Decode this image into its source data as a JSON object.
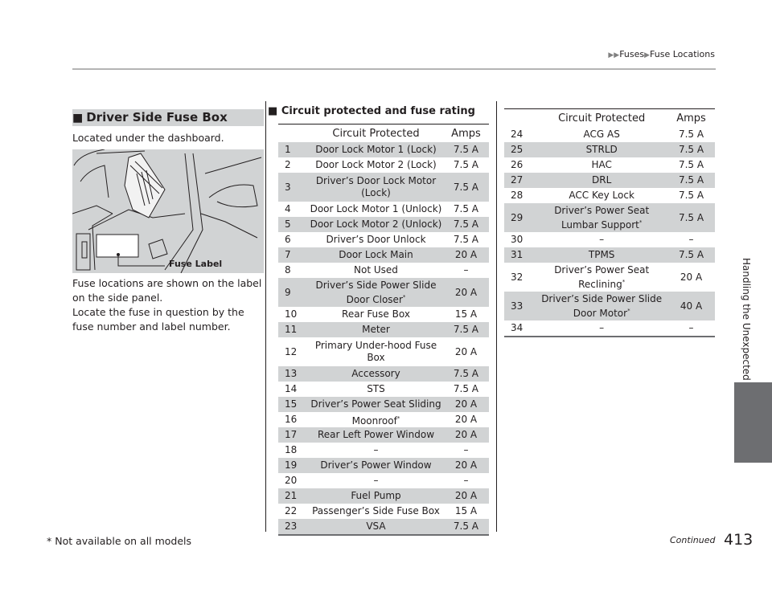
{
  "breadcrumb": {
    "items": [
      "Fuses",
      "Fuse Locations"
    ]
  },
  "side_tab": {
    "label": "Handling the Unexpected"
  },
  "left": {
    "section_title": "Driver Side Fuse Box",
    "intro": "Located under the dashboard.",
    "figure_callout": "Fuse Label",
    "body_lines": [
      "Fuse locations are shown on the label on the side panel.",
      "Locate the fuse in question by the fuse number and label number."
    ]
  },
  "table_section_title": "Circuit protected and fuse rating",
  "table_headers": {
    "num": "",
    "circuit": "Circuit Protected",
    "amps": "Amps"
  },
  "table1_rows": [
    {
      "num": "1",
      "circuit": "Door Lock Motor 1 (Lock)",
      "amps": "7.5 A"
    },
    {
      "num": "2",
      "circuit": "Door Lock Motor 2 (Lock)",
      "amps": "7.5 A"
    },
    {
      "num": "3",
      "circuit": "Driver’s Door Lock Motor (Lock)",
      "amps": "7.5 A"
    },
    {
      "num": "4",
      "circuit": "Door Lock Motor 1 (Unlock)",
      "amps": "7.5 A"
    },
    {
      "num": "5",
      "circuit": "Door Lock Motor 2 (Unlock)",
      "amps": "7.5 A"
    },
    {
      "num": "6",
      "circuit": "Driver’s Door Unlock",
      "amps": "7.5 A"
    },
    {
      "num": "7",
      "circuit": "Door Lock Main",
      "amps": "20 A"
    },
    {
      "num": "8",
      "circuit": "Not Used",
      "amps": "–"
    },
    {
      "num": "9",
      "circuit": "Driver’s Side Power Slide Door Closer",
      "note": "*",
      "amps": "20 A"
    },
    {
      "num": "10",
      "circuit": "Rear Fuse Box",
      "amps": "15 A"
    },
    {
      "num": "11",
      "circuit": "Meter",
      "amps": "7.5 A"
    },
    {
      "num": "12",
      "circuit": "Primary Under-hood Fuse Box",
      "amps": "20 A"
    },
    {
      "num": "13",
      "circuit": "Accessory",
      "amps": "7.5 A"
    },
    {
      "num": "14",
      "circuit": "STS",
      "amps": "7.5 A"
    },
    {
      "num": "15",
      "circuit": "Driver’s Power Seat Sliding",
      "amps": "20 A"
    },
    {
      "num": "16",
      "circuit": "Moonroof",
      "note": "*",
      "amps": "20 A"
    },
    {
      "num": "17",
      "circuit": "Rear Left Power Window",
      "amps": "20 A"
    },
    {
      "num": "18",
      "circuit": "–",
      "amps": "–"
    },
    {
      "num": "19",
      "circuit": "Driver’s Power Window",
      "amps": "20 A"
    },
    {
      "num": "20",
      "circuit": "–",
      "amps": "–"
    },
    {
      "num": "21",
      "circuit": "Fuel Pump",
      "amps": "20 A"
    },
    {
      "num": "22",
      "circuit": "Passenger’s Side Fuse Box",
      "amps": "15 A"
    },
    {
      "num": "23",
      "circuit": "VSA",
      "amps": "7.5 A"
    }
  ],
  "table2_rows": [
    {
      "num": "24",
      "circuit": "ACG AS",
      "amps": "7.5 A"
    },
    {
      "num": "25",
      "circuit": "STRLD",
      "amps": "7.5 A"
    },
    {
      "num": "26",
      "circuit": "HAC",
      "amps": "7.5 A"
    },
    {
      "num": "27",
      "circuit": "DRL",
      "amps": "7.5 A"
    },
    {
      "num": "28",
      "circuit": "ACC Key Lock",
      "amps": "7.5 A"
    },
    {
      "num": "29",
      "circuit": "Driver’s Power Seat Lumbar Support",
      "note": "*",
      "amps": "7.5 A"
    },
    {
      "num": "30",
      "circuit": "–",
      "amps": "–"
    },
    {
      "num": "31",
      "circuit": "TPMS",
      "amps": "7.5 A"
    },
    {
      "num": "32",
      "circuit": "Driver’s Power Seat Reclining",
      "note": "*",
      "amps": "20 A"
    },
    {
      "num": "33",
      "circuit": "Driver’s Side Power Slide Door Motor",
      "note": "*",
      "amps": "40 A"
    },
    {
      "num": "34",
      "circuit": "–",
      "amps": "–"
    }
  ],
  "footer": {
    "footnote": "* Not available on all models",
    "continued": "Continued",
    "page_number": "413"
  },
  "colors": {
    "shade": "#d1d3d4",
    "tab": "#6d6e71",
    "text": "#231f20"
  }
}
